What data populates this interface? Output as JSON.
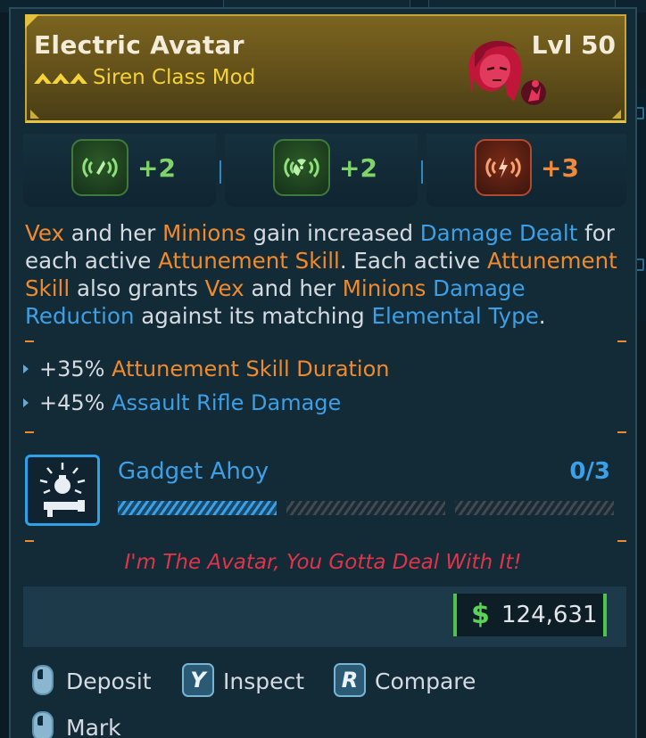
{
  "item": {
    "name": "Electric Avatar",
    "level": "Lvl 50",
    "type": "Siren Class Mod",
    "rarity_icon": "legendary-chevrons-icon",
    "portrait_icon": "vex-portrait-icon"
  },
  "skills": [
    {
      "icon": "radiation-wave-green-icon",
      "bonus": "+2",
      "color": "#7fd36a"
    },
    {
      "icon": "radiation-trefoil-green-icon",
      "bonus": "+2",
      "color": "#7fd36a"
    },
    {
      "icon": "lightning-bolt-orange-icon",
      "bonus": "+3",
      "color": "#f08a3a"
    }
  ],
  "description": [
    {
      "t": "Vex",
      "c": "o"
    },
    {
      "t": " and her ",
      "c": ""
    },
    {
      "t": "Minions",
      "c": "o"
    },
    {
      "t": " gain increased ",
      "c": ""
    },
    {
      "t": "Damage Dealt",
      "c": "b"
    },
    {
      "t": " for each active ",
      "c": ""
    },
    {
      "t": "Attunement Skill",
      "c": "o"
    },
    {
      "t": ". Each active ",
      "c": ""
    },
    {
      "t": "Attunement Skill",
      "c": "o"
    },
    {
      "t": " also grants ",
      "c": ""
    },
    {
      "t": "Vex",
      "c": "o"
    },
    {
      "t": " and her ",
      "c": ""
    },
    {
      "t": "Minions",
      "c": "o"
    },
    {
      "t": " ",
      "c": ""
    },
    {
      "t": "Damage Reduction",
      "c": "b"
    },
    {
      "t": " against its matching ",
      "c": ""
    },
    {
      "t": "Elemental Type",
      "c": "b"
    },
    {
      "t": ".",
      "c": ""
    }
  ],
  "stats": [
    {
      "value": "+35%",
      "label": "Attunement Skill Duration",
      "color": "#f08a2e"
    },
    {
      "value": "+45%",
      "label": "Assault Rifle Damage",
      "color": "#3d9fe6"
    }
  ],
  "ability": {
    "name": "Gadget Ahoy",
    "count": "0/3",
    "icon": "gadget-grenade-launcher-icon",
    "progress_segments": [
      true,
      false,
      false
    ]
  },
  "flavor": "I'm The Avatar, You Gotta Deal With It!",
  "price": {
    "symbol": "$",
    "value": "124,631",
    "color": "#5bd356"
  },
  "actions": [
    {
      "key": "mouse",
      "label": "Deposit"
    },
    {
      "key": "Y",
      "label": "Inspect"
    },
    {
      "key": "R",
      "label": "Compare"
    },
    {
      "key": "mouse",
      "label": "Mark"
    }
  ]
}
